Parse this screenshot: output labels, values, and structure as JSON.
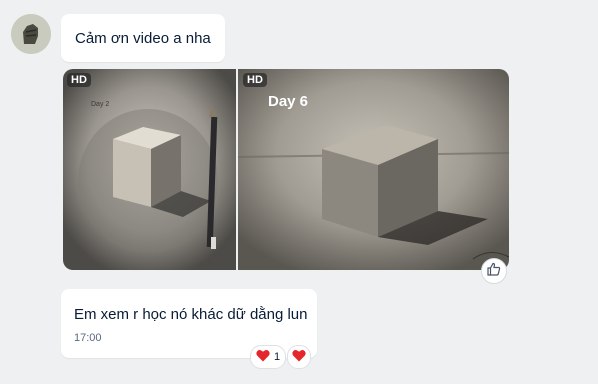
{
  "messages": [
    {
      "text": "Cảm ơn video a nha"
    },
    {
      "text": "Em xem r học nó khác dữ dằng lun",
      "time": "17:00"
    }
  ],
  "photos": [
    {
      "quality": "HD",
      "caption": "Day 2"
    },
    {
      "quality": "HD",
      "caption": "Day 6"
    }
  ],
  "reactions": {
    "heart_count": "1",
    "icon": "heart-icon",
    "color": "#e5262a"
  },
  "icons": {
    "react_button": "thumbs-up-icon"
  }
}
